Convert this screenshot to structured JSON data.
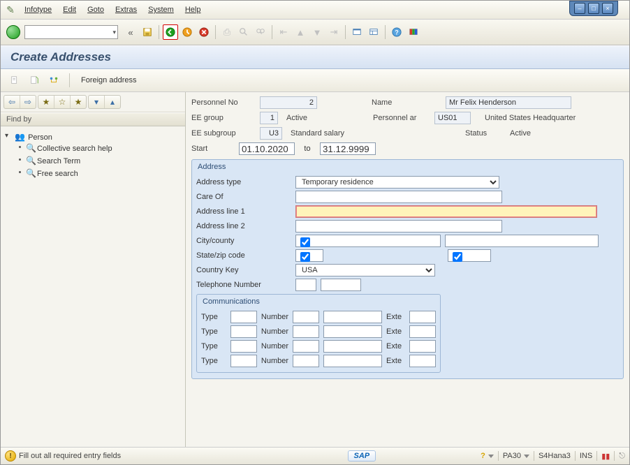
{
  "menubar": {
    "items": [
      "Infotype",
      "Edit",
      "Goto",
      "Extras",
      "System",
      "Help"
    ]
  },
  "toolbar": {
    "combo_value": "",
    "icons": {
      "ok": "ok-icon",
      "laquo": "«",
      "save": "save-icon",
      "back": "back-icon",
      "exit": "exit-icon",
      "cancel": "cancel-icon",
      "print": "print-icon",
      "find": "find-icon",
      "findnext": "find-next-icon",
      "firstpage": "first-page-icon",
      "prevpage": "prev-page-icon",
      "nextpage": "next-page-icon",
      "lastpage": "last-page-icon",
      "newsession": "new-session-icon",
      "layout": "layout-icon",
      "help": "help-icon",
      "guixt": "guixt-icon"
    }
  },
  "title": "Create Addresses",
  "subtoolbar": {
    "foreign_address": "Foreign address"
  },
  "sidebar": {
    "find_header": "Find by",
    "root": "Person",
    "children": [
      "Collective search help",
      "Search Term",
      "Free search"
    ]
  },
  "header": {
    "labels": {
      "personnel_no": "Personnel No",
      "name": "Name",
      "ee_group": "EE group",
      "ee_group_text": "Active",
      "personnel_area": "Personnel ar",
      "personnel_area_text": "United States Headquarter",
      "ee_subgroup": "EE subgroup",
      "ee_subgroup_text": "Standard salary",
      "status_lbl": "Status",
      "status_val": "Active",
      "start": "Start",
      "to": "to"
    },
    "values": {
      "personnel_no": "2",
      "name": "Mr Felix Henderson",
      "ee_group": "1",
      "personnel_area": "US01",
      "ee_subgroup": "U3",
      "start": "01.10.2020",
      "to": "31.12.9999"
    }
  },
  "address": {
    "group_title": "Address",
    "labels": {
      "type": "Address type",
      "careof": "Care Of",
      "line1": "Address line 1",
      "line2": "Address line 2",
      "city": "City/county",
      "state": "State/zip code",
      "country": "Country Key",
      "phone": "Telephone Number"
    },
    "values": {
      "type": "Temporary residence",
      "careof": "",
      "line1": "",
      "line2": "",
      "city": "",
      "county": "",
      "state": "",
      "zip": "",
      "country": "USA",
      "phone_area": "",
      "phone_num": ""
    }
  },
  "communications": {
    "group_title": "Communications",
    "labels": {
      "type": "Type",
      "number": "Number",
      "ext": "Exte"
    },
    "rows": 4
  },
  "statusbar": {
    "message": "Fill out all required entry fields",
    "sap_logo": "SAP",
    "help": "?",
    "tcode": "PA30",
    "system": "S4Hana3",
    "ins": "INS"
  },
  "colors": {
    "accent": "#5e88b9",
    "required_bg": "#fff4ba"
  }
}
